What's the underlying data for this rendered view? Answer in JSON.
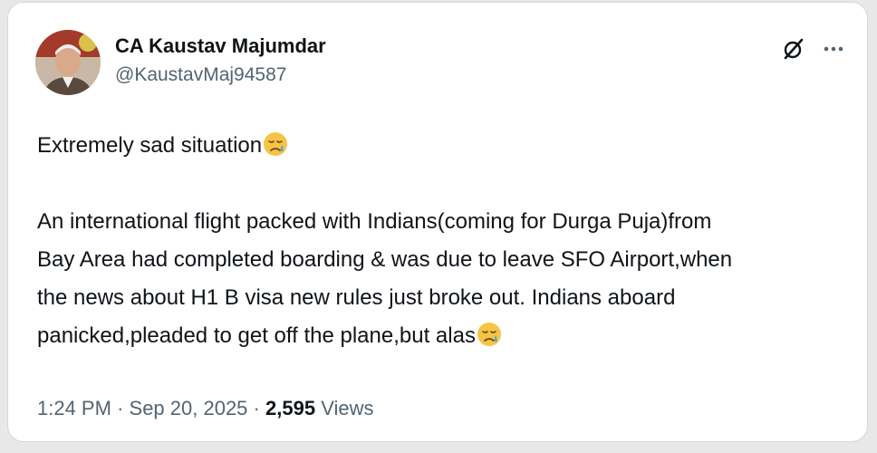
{
  "author": {
    "display_name": "CA Kaustav Majumdar",
    "handle": "@KaustavMaj94587",
    "avatar_icon": "profile-photo"
  },
  "actions": {
    "grok_icon": "grok-icon",
    "more_icon": "more-options-icon"
  },
  "tweet": {
    "line1": "Extremely sad situation",
    "emoji1": "sad-crying-face-emoji",
    "para2_a": "An international flight packed with Indians(coming for Durga Puja)from",
    "para2_b": "Bay Area had completed boarding & was due to leave SFO Airport,when",
    "para2_c": "the news about H1 B visa new rules just broke out. Indians aboard",
    "para2_d": "panicked,pleaded to get off the plane,but alas",
    "emoji2": "sad-crying-face-emoji"
  },
  "meta": {
    "time": "1:24 PM",
    "separator": "·",
    "date": "Sep 20, 2025",
    "views_count": "2,595",
    "views_label": "Views"
  },
  "colors": {
    "text_primary": "#0f1419",
    "text_secondary": "#536471",
    "card_border": "#d7d7d7"
  }
}
